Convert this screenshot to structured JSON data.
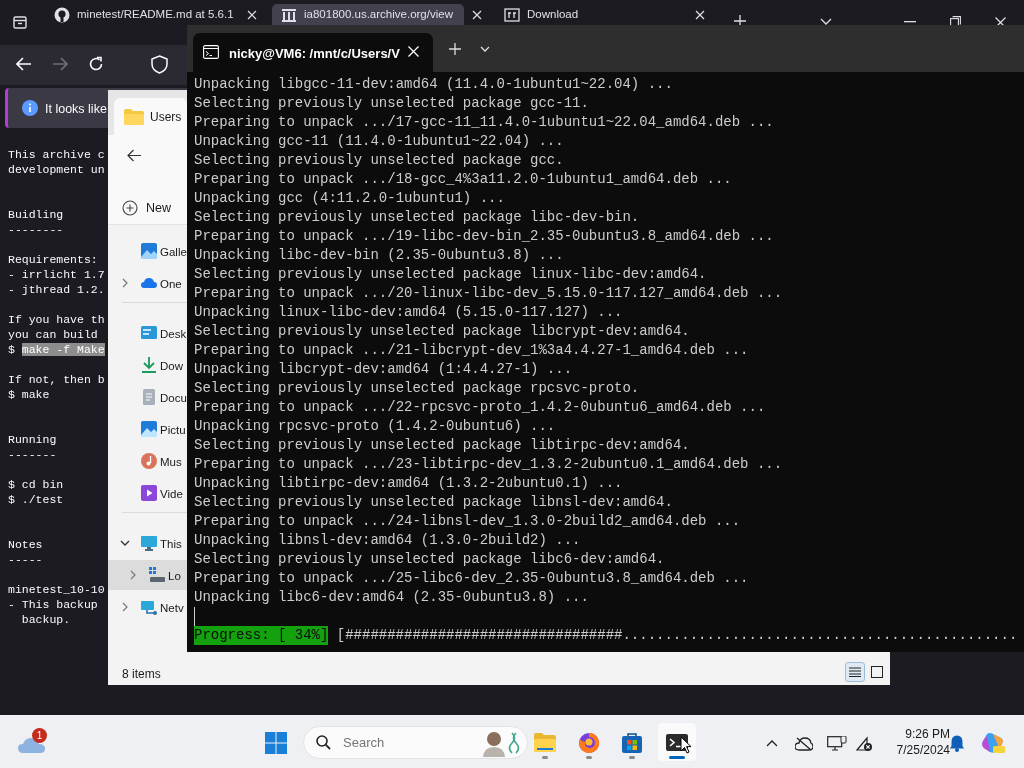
{
  "browser": {
    "tabs": [
      {
        "title": "minetest/README.md at 5.6.1",
        "selected": false,
        "kind": "github"
      },
      {
        "title": "ia801800.us.archive.org/view",
        "selected": true,
        "kind": "archive"
      },
      {
        "title": "Download",
        "selected": false,
        "kind": "download"
      }
    ],
    "notification": "It looks like",
    "page_blocks": [
      {
        "kind": "para",
        "lines": [
          {
            "text": "This archive c"
          },
          {
            "text": "development un"
          }
        ]
      },
      {
        "kind": "heading",
        "lines": [
          {
            "text": "Buidling"
          },
          {
            "text": "--------"
          }
        ]
      },
      {
        "kind": "para",
        "lines": [
          {
            "text": "Requirements:"
          },
          {
            "text": "- irrlicht 1.7"
          },
          {
            "text": "- jthread 1.2."
          }
        ]
      },
      {
        "kind": "para",
        "lines": [
          {
            "text": "If you have th"
          },
          {
            "text": "you can build"
          },
          {
            "text": "$ ",
            "selection": "make -f Make"
          }
        ]
      },
      {
        "kind": "para",
        "lines": [
          {
            "text": "If not, then b"
          },
          {
            "text": "$ make"
          }
        ]
      },
      {
        "kind": "heading",
        "lines": [
          {
            "text": "Running"
          },
          {
            "text": "-------"
          }
        ]
      },
      {
        "kind": "para",
        "lines": [
          {
            "text": "$ cd bin"
          },
          {
            "text": "$ ./test"
          }
        ]
      },
      {
        "kind": "heading",
        "lines": [
          {
            "text": "Notes"
          },
          {
            "text": "-----"
          }
        ]
      },
      {
        "kind": "para",
        "lines": [
          {
            "text": "minetest_10-10"
          },
          {
            "text": "- This backup"
          },
          {
            "text": "  backup."
          }
        ]
      }
    ]
  },
  "explorer": {
    "tab": "Users",
    "new_button": "New",
    "nav_groups": [
      [
        {
          "label": "Galle",
          "expandable": false
        },
        {
          "label": "One",
          "expandable": true,
          "expanded": false
        }
      ],
      [
        {
          "label": "Desk"
        },
        {
          "label": "Dow"
        },
        {
          "label": "Docu"
        },
        {
          "label": "Pictu"
        },
        {
          "label": "Mus"
        },
        {
          "label": "Vide"
        }
      ],
      [
        {
          "label": "This",
          "expandable": true,
          "expanded": true,
          "children": [
            {
              "label": "Lo",
              "expandable": true,
              "expanded": false,
              "selected": true
            }
          ]
        },
        {
          "label": "Netv",
          "expandable": true,
          "expanded": false
        }
      ]
    ],
    "status": "8 items",
    "views": [
      {
        "kind": "details",
        "selected": true
      },
      {
        "kind": "tiles",
        "selected": false
      }
    ]
  },
  "terminal": {
    "tab_title": "nicky@VM6: /mnt/c/Users/V",
    "lines": [
      "Unpacking libgcc-11-dev:amd64 (11.4.0-1ubuntu1~22.04) ...",
      "Selecting previously unselected package gcc-11.",
      "Preparing to unpack .../17-gcc-11_11.4.0-1ubuntu1~22.04_amd64.deb ...",
      "Unpacking gcc-11 (11.4.0-1ubuntu1~22.04) ...",
      "Selecting previously unselected package gcc.",
      "Preparing to unpack .../18-gcc_4%3a11.2.0-1ubuntu1_amd64.deb ...",
      "Unpacking gcc (4:11.2.0-1ubuntu1) ...",
      "Selecting previously unselected package libc-dev-bin.",
      "Preparing to unpack .../19-libc-dev-bin_2.35-0ubuntu3.8_amd64.deb ...",
      "Unpacking libc-dev-bin (2.35-0ubuntu3.8) ...",
      "Selecting previously unselected package linux-libc-dev:amd64.",
      "Preparing to unpack .../20-linux-libc-dev_5.15.0-117.127_amd64.deb ...",
      "Unpacking linux-libc-dev:amd64 (5.15.0-117.127) ...",
      "Selecting previously unselected package libcrypt-dev:amd64.",
      "Preparing to unpack .../21-libcrypt-dev_1%3a4.4.27-1_amd64.deb ...",
      "Unpacking libcrypt-dev:amd64 (1:4.4.27-1) ...",
      "Selecting previously unselected package rpcsvc-proto.",
      "Preparing to unpack .../22-rpcsvc-proto_1.4.2-0ubuntu6_amd64.deb ...",
      "Unpacking rpcsvc-proto (1.4.2-0ubuntu6) ...",
      "Selecting previously unselected package libtirpc-dev:amd64.",
      "Preparing to unpack .../23-libtirpc-dev_1.3.2-2ubuntu0.1_amd64.deb ...",
      "Unpacking libtirpc-dev:amd64 (1.3.2-2ubuntu0.1) ...",
      "Selecting previously unselected package libnsl-dev:amd64.",
      "Preparing to unpack .../24-libnsl-dev_1.3.0-2build2_amd64.deb ...",
      "Unpacking libnsl-dev:amd64 (1.3.0-2build2) ...",
      "Selecting previously unselected package libc6-dev:amd64.",
      "Preparing to unpack .../25-libc6-dev_2.35-0ubuntu3.8_amd64.deb ...",
      "Unpacking libc6-dev:amd64 (2.35-0ubuntu3.8) ..."
    ],
    "progress": {
      "label": "Progress: [ 34%]",
      "bar": "[#################################..............................................."
    }
  },
  "taskbar": {
    "weather_badge": "1",
    "search_placeholder": "Search",
    "apps": [
      {
        "kind": "explorer",
        "active": false
      },
      {
        "kind": "firefox",
        "active": false
      },
      {
        "kind": "store",
        "active": false
      },
      {
        "kind": "terminal",
        "active": true
      }
    ],
    "time": "9:26 PM",
    "date": "7/25/2024"
  }
}
